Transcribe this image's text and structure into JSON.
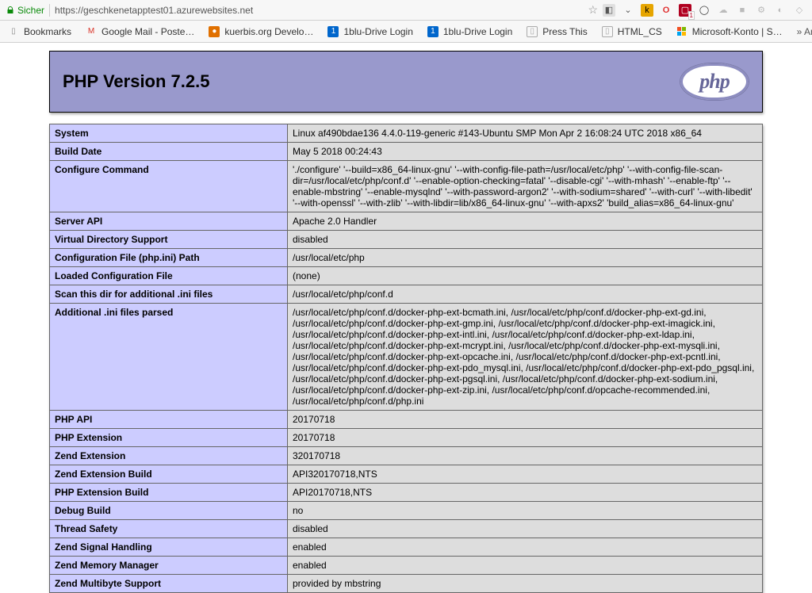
{
  "chrome": {
    "secure_label": "Sicher",
    "url_display": "https://geschkenetapptest01.azurewebsites.net"
  },
  "bookmarks": {
    "items": [
      {
        "label": "Bookmarks",
        "icon": "folder"
      },
      {
        "label": "Google Mail - Poste…",
        "icon": "gmail"
      },
      {
        "label": "kuerbis.org Develo…",
        "icon": "kuerbis"
      },
      {
        "label": "1blu-Drive Login",
        "icon": "1blu"
      },
      {
        "label": "1blu-Drive Login",
        "icon": "1blu"
      },
      {
        "label": "Press This",
        "icon": "page"
      },
      {
        "label": "HTML_CS",
        "icon": "page"
      },
      {
        "label": "Microsoft-Konto | S…",
        "icon": "microsoft"
      }
    ],
    "overflow": "Ande"
  },
  "phpinfo": {
    "title": "PHP Version 7.2.5",
    "logo_text": "php",
    "rows": [
      {
        "k": "System",
        "v": "Linux af490bdae136 4.4.0-119-generic #143-Ubuntu SMP Mon Apr 2 16:08:24 UTC 2018 x86_64"
      },
      {
        "k": "Build Date",
        "v": "May 5 2018 00:24:43"
      },
      {
        "k": "Configure Command",
        "v": "'./configure' '--build=x86_64-linux-gnu' '--with-config-file-path=/usr/local/etc/php' '--with-config-file-scan-dir=/usr/local/etc/php/conf.d' '--enable-option-checking=fatal' '--disable-cgi' '--with-mhash' '--enable-ftp' '--enable-mbstring' '--enable-mysqlnd' '--with-password-argon2' '--with-sodium=shared' '--with-curl' '--with-libedit' '--with-openssl' '--with-zlib' '--with-libdir=lib/x86_64-linux-gnu' '--with-apxs2' 'build_alias=x86_64-linux-gnu'"
      },
      {
        "k": "Server API",
        "v": "Apache 2.0 Handler"
      },
      {
        "k": "Virtual Directory Support",
        "v": "disabled"
      },
      {
        "k": "Configuration File (php.ini) Path",
        "v": "/usr/local/etc/php"
      },
      {
        "k": "Loaded Configuration File",
        "v": "(none)"
      },
      {
        "k": "Scan this dir for additional .ini files",
        "v": "/usr/local/etc/php/conf.d"
      },
      {
        "k": "Additional .ini files parsed",
        "v": "/usr/local/etc/php/conf.d/docker-php-ext-bcmath.ini, /usr/local/etc/php/conf.d/docker-php-ext-gd.ini, /usr/local/etc/php/conf.d/docker-php-ext-gmp.ini, /usr/local/etc/php/conf.d/docker-php-ext-imagick.ini, /usr/local/etc/php/conf.d/docker-php-ext-intl.ini, /usr/local/etc/php/conf.d/docker-php-ext-ldap.ini, /usr/local/etc/php/conf.d/docker-php-ext-mcrypt.ini, /usr/local/etc/php/conf.d/docker-php-ext-mysqli.ini, /usr/local/etc/php/conf.d/docker-php-ext-opcache.ini, /usr/local/etc/php/conf.d/docker-php-ext-pcntl.ini, /usr/local/etc/php/conf.d/docker-php-ext-pdo_mysql.ini, /usr/local/etc/php/conf.d/docker-php-ext-pdo_pgsql.ini, /usr/local/etc/php/conf.d/docker-php-ext-pgsql.ini, /usr/local/etc/php/conf.d/docker-php-ext-sodium.ini, /usr/local/etc/php/conf.d/docker-php-ext-zip.ini, /usr/local/etc/php/conf.d/opcache-recommended.ini, /usr/local/etc/php/conf.d/php.ini"
      },
      {
        "k": "PHP API",
        "v": "20170718"
      },
      {
        "k": "PHP Extension",
        "v": "20170718"
      },
      {
        "k": "Zend Extension",
        "v": "320170718"
      },
      {
        "k": "Zend Extension Build",
        "v": "API320170718,NTS"
      },
      {
        "k": "PHP Extension Build",
        "v": "API20170718,NTS"
      },
      {
        "k": "Debug Build",
        "v": "no"
      },
      {
        "k": "Thread Safety",
        "v": "disabled"
      },
      {
        "k": "Zend Signal Handling",
        "v": "enabled"
      },
      {
        "k": "Zend Memory Manager",
        "v": "enabled"
      },
      {
        "k": "Zend Multibyte Support",
        "v": "provided by mbstring"
      }
    ]
  }
}
